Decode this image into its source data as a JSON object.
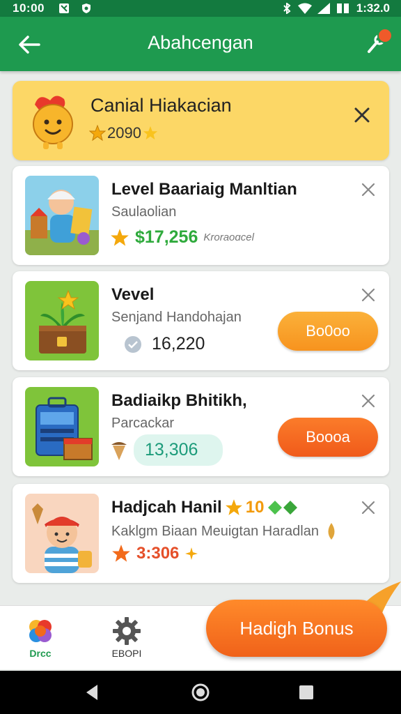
{
  "status_bar": {
    "time": "10:00",
    "battery_text": "1:32.0"
  },
  "app_bar": {
    "title": "Abahcengan"
  },
  "banner": {
    "title": "Canial Hiakacian",
    "score": "2090"
  },
  "cards": [
    {
      "title": "Level Baariaig Manltian",
      "subtitle": "Saulaolian",
      "amount": "$17,256",
      "note": "Kroraoɑcel"
    },
    {
      "title": "Vevel",
      "subtitle": "Senjand Handohajan",
      "amount": "16,220",
      "button": "Bo0oo"
    },
    {
      "title": "Badiaikp Bhitikh,",
      "subtitle": "Parcackar",
      "amount": "13,306",
      "button": "Boooa"
    },
    {
      "title": "Hadjcah Hanil",
      "title_badge": "10",
      "subtitle": "Kaklgm Biaan Meuigtan Haradlan",
      "amount": "3:306"
    }
  ],
  "bottom_nav": {
    "item1": "Drcc",
    "item2": "EBOPI"
  },
  "bonus_button": "Hadigh Bonus",
  "colors": {
    "green": "#1e9a4f",
    "orange": "#f7931e",
    "yellow": "#fcd766",
    "price_green": "#2faa3c"
  }
}
